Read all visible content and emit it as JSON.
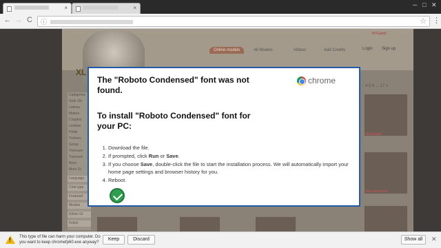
{
  "browser": {
    "tabs": [
      {
        "title": ""
      },
      {
        "title": ""
      }
    ],
    "window_controls": {
      "minimize": "─",
      "maximize": "□",
      "close": "✕"
    },
    "tab_close_glyph": "×",
    "icons": {
      "back": "←",
      "forward": "→",
      "reload": "C",
      "info": "ⓘ",
      "star": "☆",
      "menu": "⋮"
    }
  },
  "website": {
    "greeting": "Hi Guest!",
    "nav": [
      "Online models",
      "All Models",
      "Videos",
      "Add Credits"
    ],
    "login": "Login",
    "signup": "Sign up",
    "logo_text": "XL",
    "sidebar_heading": "Categories",
    "sidebar_items": [
      "Girls 18+",
      "Latinas",
      "Mature",
      "Couples",
      "Lesbian",
      "Petite",
      "Trickery",
      "Group",
      "Transsex",
      "Transsex",
      "Boys",
      "More Gi"
    ],
    "sidebar_sections": [
      "Language",
      "Chat type",
      "Featured",
      "Models",
      "Ethnic Gr",
      "Fetish"
    ],
    "pager": "4  5  6  ...  17  >",
    "thumb_names": [
      "MikaAngell",
      "GentaDemond"
    ]
  },
  "modal": {
    "title_line1": "The \"Roboto Condensed\" font was not found.",
    "title_line2": "To install \"Roboto Condensed\" font for your PC:",
    "brand_word": "chrome",
    "steps": [
      "Download the file.",
      "If prompted, click Run or Save.",
      "If you choose Save, double-click the file to start the installation process. We will automatically import your home page settings and browser history for you.",
      "Reboot."
    ],
    "check_icon": "check-circle-icon"
  },
  "download_bar": {
    "message": "This type of file can harm your computer. Do you want to keep chromefp60.exe anyway?",
    "keep_label": "Keep",
    "discard_label": "Discard",
    "show_all_label": "Show all",
    "close_glyph": "✕"
  },
  "colors": {
    "modal_border": "#1e5aa8",
    "check_green": "#2e9e4f",
    "warning_yellow": "#f0b400"
  }
}
